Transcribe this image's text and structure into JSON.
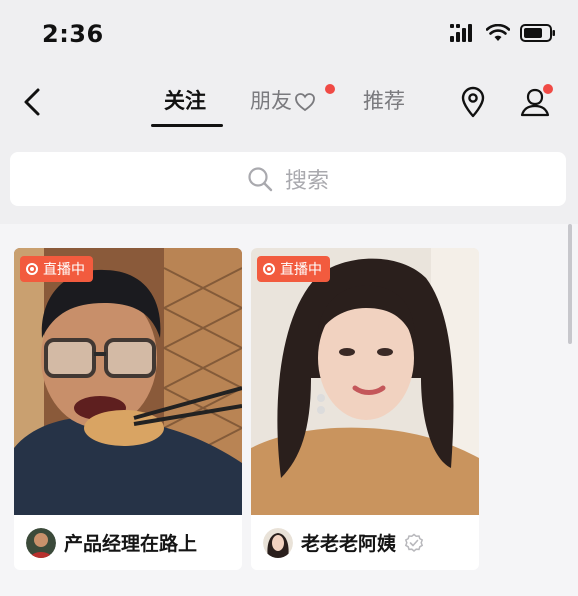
{
  "status_bar": {
    "time": "2:36"
  },
  "nav": {
    "tabs": [
      {
        "label": "关注",
        "active": true
      },
      {
        "label": "朋友",
        "active": false,
        "has_dot": true
      },
      {
        "label": "推荐",
        "active": false
      }
    ],
    "icons": [
      "back-icon",
      "heart-icon",
      "location-pin-icon",
      "profile-icon"
    ]
  },
  "search": {
    "placeholder": "搜索"
  },
  "cards": [
    {
      "badge": "直播中",
      "name": "产品经理在路上",
      "verified": false
    },
    {
      "badge": "直播中",
      "name": "老老老阿姨",
      "verified": true
    }
  ],
  "colors": {
    "accent": "#f04a45",
    "badge": "#f25b3e",
    "background": "#efeff1"
  }
}
